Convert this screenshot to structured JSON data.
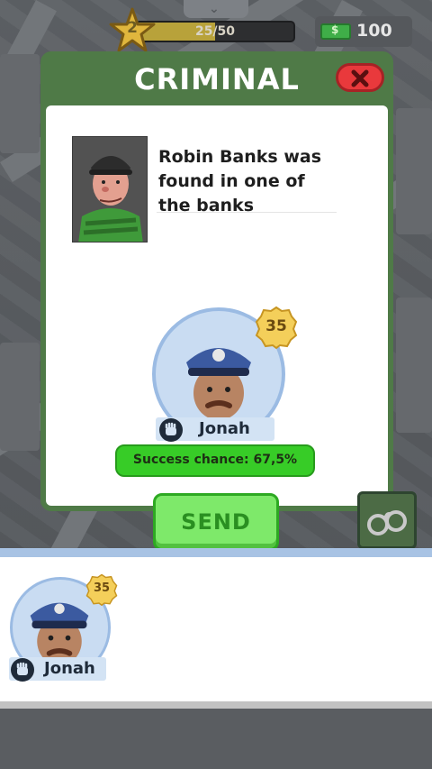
{
  "hud": {
    "level": "2",
    "xp_text": "25/50",
    "xp_progress": 0.5,
    "money": "100"
  },
  "modal": {
    "title": "CRIMINAL",
    "message": "Robin Banks was found in one of the banks",
    "officer": {
      "name": "Jonah",
      "level": "35"
    },
    "success_chance_text": "Success chance: 67,5%",
    "send_label": "SEND"
  },
  "tray": {
    "officers": [
      {
        "name": "Jonah",
        "level": "35"
      }
    ]
  },
  "colors": {
    "modal_frame": "#4f7a47",
    "close_red": "#e9393c",
    "success_green": "#37cc27",
    "send_green": "#7ee96a",
    "officer_ring": "#c9dcf2"
  },
  "icons": {
    "level": "star-icon",
    "money": "cash-icon",
    "close": "close-icon",
    "badge": "police-badge-icon",
    "class": "fist-icon",
    "arrest": "handcuffs-icon"
  }
}
